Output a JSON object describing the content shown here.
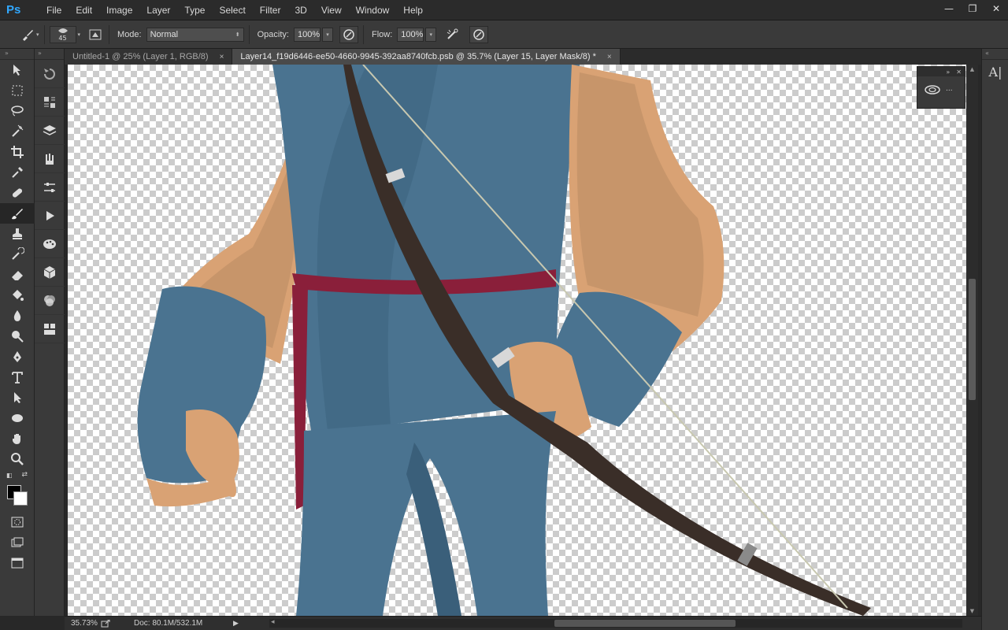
{
  "app": {
    "logo": "Ps"
  },
  "menu": [
    "File",
    "Edit",
    "Image",
    "Layer",
    "Type",
    "Select",
    "Filter",
    "3D",
    "View",
    "Window",
    "Help"
  ],
  "window_controls": {
    "minimize": "—",
    "restore": "❐",
    "close": "✕"
  },
  "options_bar": {
    "brush_size": "45",
    "mode_label": "Mode:",
    "mode_value": "Normal",
    "opacity_label": "Opacity:",
    "opacity_value": "100%",
    "flow_label": "Flow:",
    "flow_value": "100%"
  },
  "tabs": [
    {
      "label": "Untitled-1 @ 25% (Layer 1, RGB/8)",
      "close": "×",
      "active": false
    },
    {
      "label": "Layer14_f19d6446-ee50-4660-9945-392aa8740fcb.psb @ 35.7% (Layer 15, Layer Mask/8) *",
      "close": "×",
      "active": true
    }
  ],
  "panel_headers": {
    "tools": "»",
    "palette": "»",
    "right": "«",
    "float": "»"
  },
  "float_panel": {
    "close": "✕",
    "more": "..."
  },
  "right_strip": {
    "icon_label": "A|"
  },
  "status": {
    "zoom": "35.73%",
    "doc": "Doc: 80.1M/532.1M",
    "play": "▶",
    "left_arrow": "◂"
  },
  "scroll": {
    "up": "▲",
    "down": "▼"
  },
  "colors": {
    "fg": "#000000",
    "bg": "#ffffff",
    "cloth": "#4a7390",
    "skin": "#d9a274",
    "belt": "#8a1f3a",
    "bow": "#3a2e28"
  }
}
